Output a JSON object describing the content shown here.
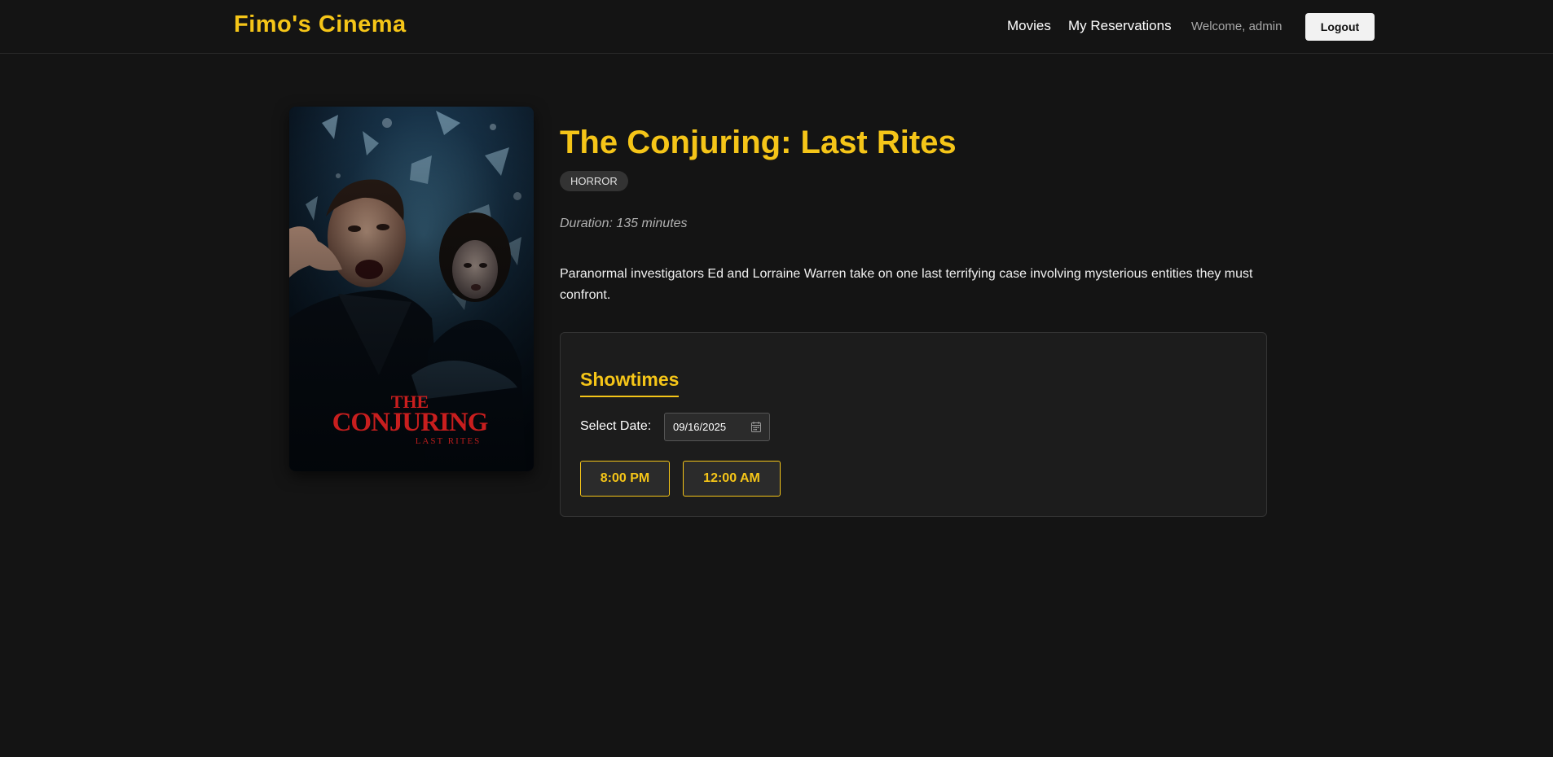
{
  "header": {
    "brand": "Fimo's Cinema",
    "nav": {
      "movies": "Movies",
      "reservations": "My Reservations"
    },
    "welcome": "Welcome, admin",
    "logout_label": "Logout"
  },
  "movie": {
    "title": "The Conjuring: Last Rites",
    "genre": "HORROR",
    "duration": "Duration: 135 minutes",
    "description": "Paranormal investigators Ed and Lorraine Warren take on one last terrifying case involving mysterious entities they must confront.",
    "poster": {
      "title_line1": "THE",
      "title_line2": "CONJURING",
      "subtitle": "LAST RITES"
    }
  },
  "showtimes": {
    "heading": "Showtimes",
    "date_label": "Select Date:",
    "date_value": "09/16/2025",
    "times": [
      "8:00 PM",
      "12:00 AM"
    ]
  },
  "colors": {
    "accent": "#f5c518",
    "background": "#141414",
    "card": "#1c1c1c"
  }
}
